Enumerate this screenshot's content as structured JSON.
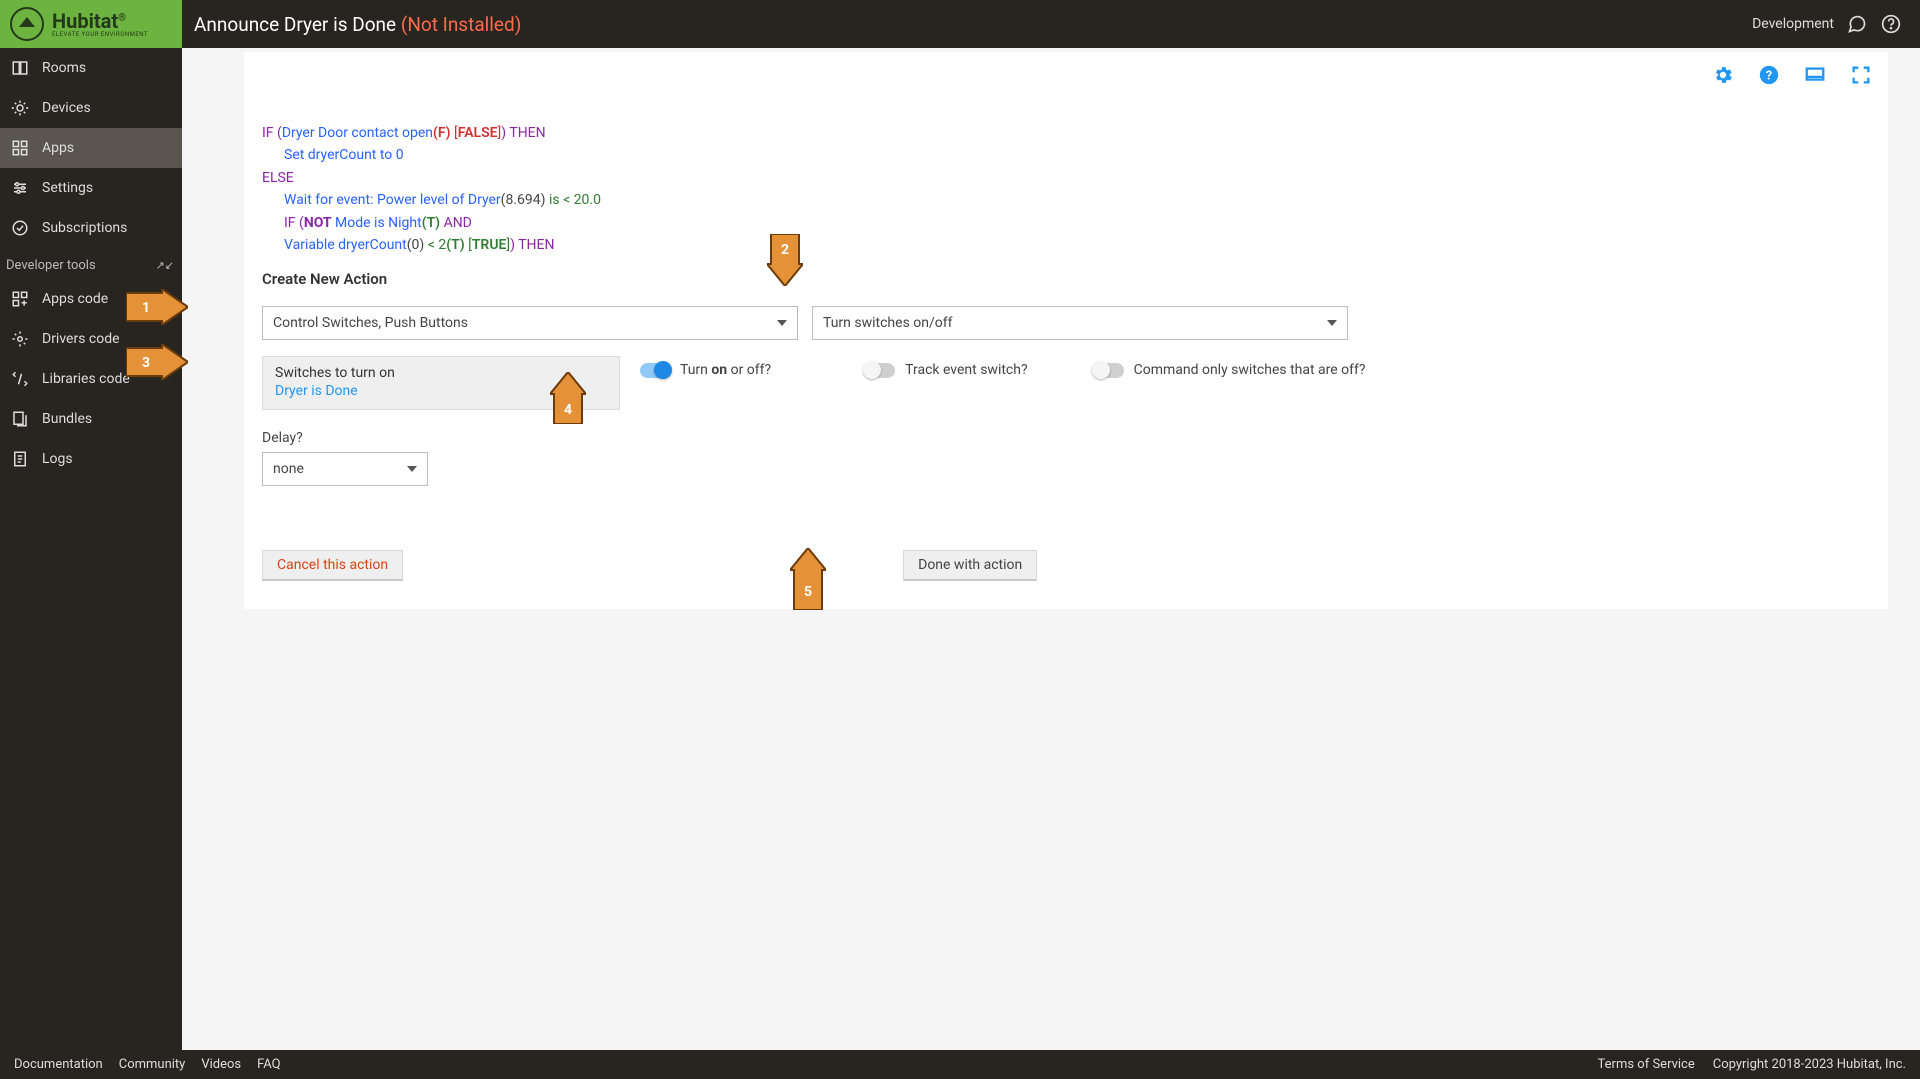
{
  "header": {
    "title": "Announce Dryer is Done",
    "status": "(Not Installed)",
    "env": "Development"
  },
  "sidebar": {
    "items": [
      {
        "label": "Rooms"
      },
      {
        "label": "Devices"
      },
      {
        "label": "Apps"
      },
      {
        "label": "Settings"
      },
      {
        "label": "Subscriptions"
      }
    ],
    "dev_header": "Developer tools",
    "dev_items": [
      {
        "label": "Apps code"
      },
      {
        "label": "Drivers code"
      },
      {
        "label": "Libraries code"
      },
      {
        "label": "Bundles"
      },
      {
        "label": "Logs"
      }
    ]
  },
  "rule": {
    "l1_if": "IF (",
    "l1_cond": "Dryer Door contact open",
    "l1_fval": "(F)",
    "l1_false": "FALSE",
    "l1_then": ") THEN",
    "l2": "Set dryerCount to 0",
    "l3": "ELSE",
    "l4_pre": "Wait for event: Power level of Dryer",
    "l4_paren": "(8.694)",
    "l4_op": " is < 20.0",
    "l5_if": "IF (",
    "l5_not": "NOT",
    "l5_mode": " Mode is Night",
    "l5_t": "(T)",
    "l5_and": "  AND",
    "l6_var": "Variable dryerCount",
    "l6_paren": "(0)",
    "l6_op": " < 2",
    "l6_t": "(T)",
    "l6_true": "TRUE",
    "l6_then": ") THEN"
  },
  "form": {
    "section_title": "Create New Action",
    "select_a": "Control Switches, Push Buttons",
    "select_b": "Turn switches on/off",
    "panel_title": "Switches to turn on",
    "panel_value": "Dryer is Done",
    "onoff_pre": "Turn ",
    "onoff_bold": "on",
    "onoff_post": " or off?",
    "track": "Track event switch?",
    "cmdonly": "Command only switches that are off?",
    "delay_label": "Delay?",
    "delay_value": "none",
    "cancel": "Cancel this action",
    "done": "Done with action"
  },
  "footer": {
    "links": [
      "Documentation",
      "Community",
      "Videos",
      "FAQ"
    ],
    "tos": "Terms of Service",
    "copy": "Copyright 2018-2023 Hubitat, Inc."
  },
  "arrows": {
    "n1": "1",
    "n2": "2",
    "n3": "3",
    "n4": "4",
    "n5": "5"
  },
  "colors": {
    "accent": "#6db33f",
    "link": "#2196f3",
    "danger": "#d84315"
  }
}
